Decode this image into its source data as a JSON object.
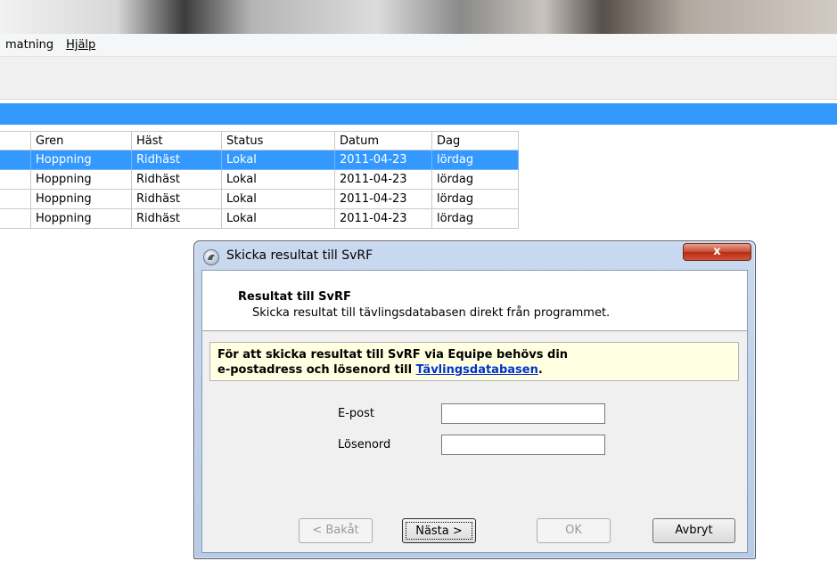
{
  "menu": {
    "items": [
      "matning",
      "Hjälp"
    ]
  },
  "table": {
    "columns": [
      "",
      "Gren",
      "Häst",
      "Status",
      "Datum",
      "Dag"
    ],
    "rows": [
      [
        "",
        "Hoppning",
        "Ridhäst",
        "Lokal",
        "2011-04-23",
        "lördag"
      ],
      [
        "",
        "Hoppning",
        "Ridhäst",
        "Lokal",
        "2011-04-23",
        "lördag"
      ],
      [
        "",
        "Hoppning",
        "Ridhäst",
        "Lokal",
        "2011-04-23",
        "lördag"
      ],
      [
        "",
        "Hoppning",
        "Ridhäst",
        "Lokal",
        "2011-04-23",
        "lördag"
      ]
    ],
    "selected_row": 0
  },
  "dialog": {
    "title": "Skicka resultat till SvRF",
    "close_glyph": "x",
    "header_title": "Resultat till SvRF",
    "header_subtitle": "Skicka resultat till tävlingsdatabasen direkt från programmet.",
    "info_line1": "För att skicka resultat till SvRF via Equipe behövs din",
    "info_line2_prefix": "e-postadress och lösenord till ",
    "info_link": "Tävlingsdatabasen",
    "info_suffix": ".",
    "email_label": "E-post",
    "email_value": "",
    "password_label": "Lösenord",
    "password_value": "",
    "buttons": {
      "back": "< Bakåt",
      "next": "Nästa >",
      "ok": "OK",
      "cancel": "Avbryt"
    }
  },
  "colors": {
    "selection": "#3399ff",
    "info_bg": "#ffffe1",
    "link": "#0033cc",
    "close_red": "#c7492f"
  }
}
